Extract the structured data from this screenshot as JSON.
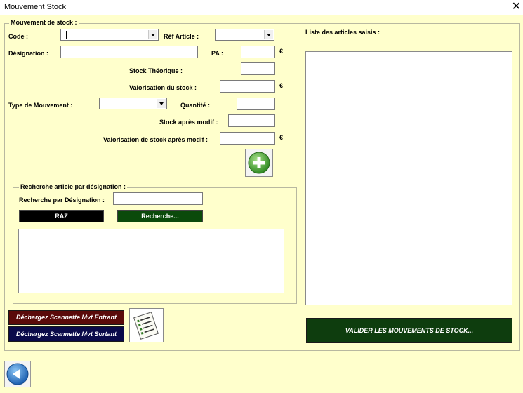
{
  "window": {
    "title": "Mouvement Stock",
    "close_symbol": "✕"
  },
  "mouvement": {
    "frame_label": "Mouvement de stock :",
    "code_label": "Code :",
    "ref_label": "Réf Article :",
    "designation_label": "Désignation :",
    "pa_label": "PA :",
    "stock_theorique_label": "Stock Théorique :",
    "valorisation_label": "Valorisation du stock :",
    "type_mouvement_label": "Type de Mouvement :",
    "quantite_label": "Quantité :",
    "stock_apres_label": "Stock après modif :",
    "valorisation_apres_label": "Valorisation de stock après modif :",
    "currency": "€"
  },
  "recherche": {
    "frame_label": "Recherche article par désignation :",
    "designation_label": "Recherche  par Désignation :",
    "raz_label": "RAZ",
    "search_label": "Recherche..."
  },
  "liste": {
    "label": "Liste des articles saisis :"
  },
  "buttons": {
    "entrant_label": "Déchargez Scannette Mvt Entrant",
    "sortant_label": "Déchargez Scannette Mvt Sortant",
    "valider_label": "VALIDER LES MOUVEMENTS DE STOCK..."
  },
  "colors": {
    "background": "#ffffcc",
    "raz_button": "#000000",
    "search_button": "#0b4a0b",
    "entrant_button": "#5a0a0a",
    "sortant_button": "#0a0a4a",
    "valider_button": "#0e3d0e",
    "add_icon": "#3f9f2f",
    "back_icon": "#1f6fc0"
  },
  "icons": [
    "add-plus-icon",
    "checklist-icon",
    "back-arrow-icon"
  ]
}
